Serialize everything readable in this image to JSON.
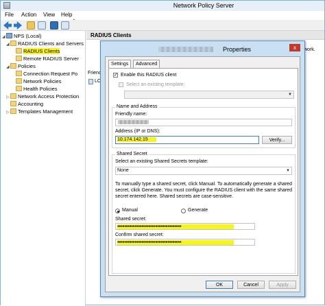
{
  "window": {
    "title": "Network Policy Server",
    "menu": [
      "File",
      "Action",
      "View",
      "Help"
    ]
  },
  "tree": {
    "items": [
      {
        "label": "NPS (Local)",
        "level": 0,
        "icon": "server-icon",
        "expander": "◢"
      },
      {
        "label": "RADIUS Clients and Servers",
        "level": 1,
        "icon": "folder-icon",
        "expander": "◢"
      },
      {
        "label": "RADIUS Clients",
        "level": 2,
        "icon": "folder-icon",
        "highlight": true
      },
      {
        "label": "Remote RADIUS Server",
        "level": 2,
        "icon": "folder-icon"
      },
      {
        "label": "Policies",
        "level": 1,
        "icon": "folder-icon",
        "expander": "◢"
      },
      {
        "label": "Connection Request Po",
        "level": 2,
        "icon": "folder-icon"
      },
      {
        "label": "Network Policies",
        "level": 2,
        "icon": "folder-icon"
      },
      {
        "label": "Health Policies",
        "level": 2,
        "icon": "folder-icon"
      },
      {
        "label": "Network Access Protection",
        "level": 1,
        "icon": "folder-icon",
        "expander": "▷"
      },
      {
        "label": "Accounting",
        "level": 1,
        "icon": "folder-icon"
      },
      {
        "label": "Templates Management",
        "level": 1,
        "icon": "folder-icon",
        "expander": "▷"
      }
    ]
  },
  "content": {
    "title": "RADIUS Clients",
    "snippet": "Friend",
    "row_label": "LC",
    "right_snippet": "work."
  },
  "dialog": {
    "title": "Properties",
    "close_glyph": "x",
    "tabs": [
      "Settings",
      "Advanced"
    ],
    "enable_label": "Enable this RADIUS client",
    "template_label": "Select an existing template:",
    "name_group": "Name and Address",
    "friendly_label": "Friendly name:",
    "address_label": "Address (IP or DNS):",
    "address_value": "10.174.142.15",
    "verify_label": "Verify...",
    "secret_group": "Shared Secret",
    "secret_template_label": "Select an existing Shared Secrets template:",
    "secret_template_value": "None",
    "instructions": "To manually type a shared secret, click Manual. To automatically generate a shared secret, click Generate. You must configure the RADIUS client with the same shared secret entered here. Shared secrets are case-sensitive.",
    "manual_label": "Manual",
    "generate_label": "Generate",
    "shared_label": "Shared secret:",
    "confirm_label": "Confirm shared secret:",
    "masked": "●●●●●●●●●●●●●●●●●●●●●●●●●●●●●●●●●●●●●",
    "ok_label": "OK",
    "cancel_label": "Cancel",
    "apply_label": "Apply"
  },
  "colors": {
    "highlight": "#fbf31f",
    "dialog_frame": "#c9e0f2",
    "close_button": "#c0392b"
  }
}
